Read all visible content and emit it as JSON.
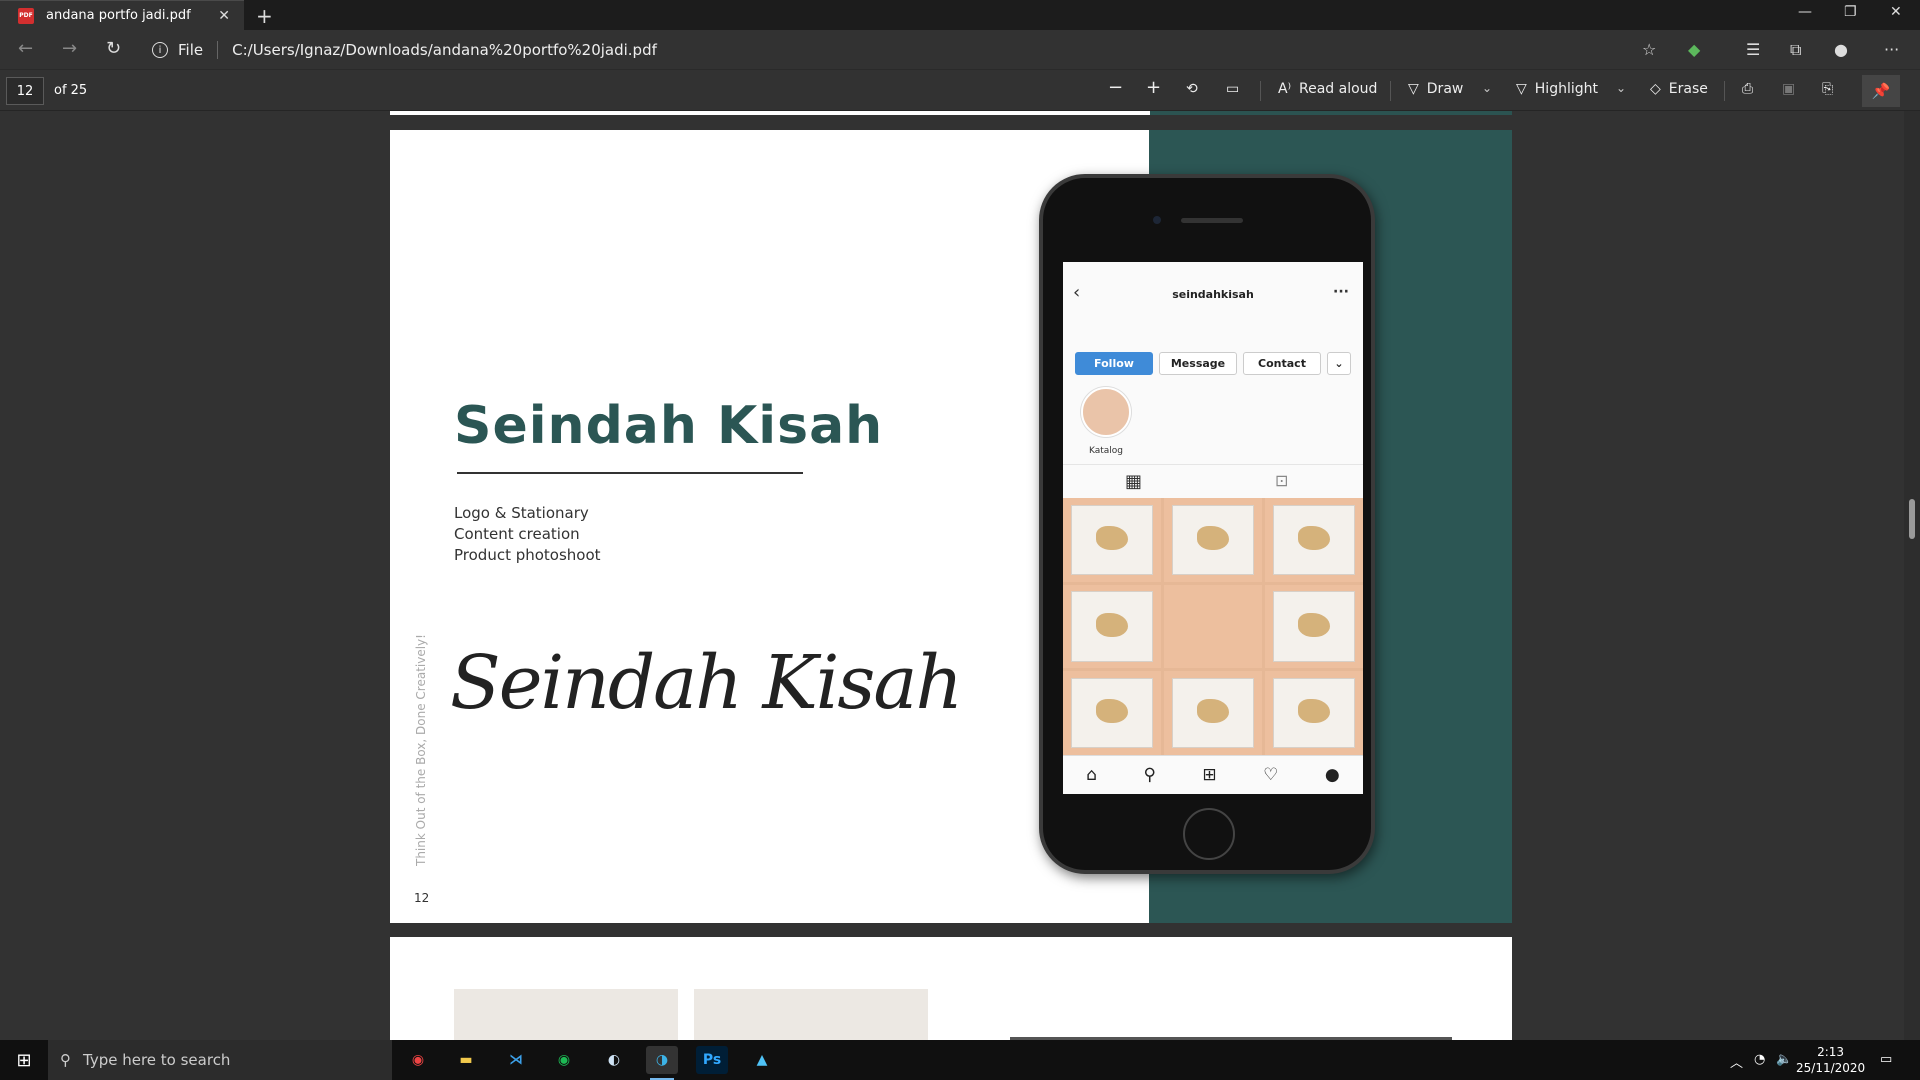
{
  "browser": {
    "tab_title": "andana portfo jadi.pdf",
    "tab_icon": "pdf-icon",
    "new_tab_label": "+",
    "address_scheme": "File",
    "address_url": "C:/Users/Ignaz/Downloads/andana%20portfo%20jadi.pdf"
  },
  "pdf_toolbar": {
    "current_page": "12",
    "page_of": "of 25",
    "read_aloud": "Read aloud",
    "draw": "Draw",
    "highlight": "Highlight",
    "erase": "Erase"
  },
  "page_content": {
    "title": "Seindah Kisah",
    "services": [
      "Logo & Stationary",
      "Content creation",
      "Product photoshoot"
    ],
    "script_logo": "Seindah Kisah",
    "tagline_vertical": "Think Out of the Box, Done Creatively!",
    "page_number": "12",
    "accent_color": "#2c5654"
  },
  "instagram": {
    "username": "seindahkisah",
    "buttons": {
      "follow": "Follow",
      "message": "Message",
      "contact": "Contact"
    },
    "highlight_label": "Katalog",
    "follow_color": "#3f8bd8"
  },
  "taskbar": {
    "search_placeholder": "Type here to search",
    "time": "2:13",
    "date": "25/11/2020"
  },
  "window_controls": {
    "minimize": "—",
    "restore": "❐",
    "close": "✕"
  }
}
